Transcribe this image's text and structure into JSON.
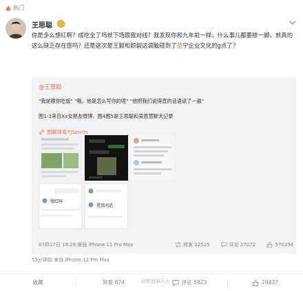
{
  "header": {
    "hot_label": "热门"
  },
  "post": {
    "username": "王思聪",
    "text_part1": "你是多么想红啊？成吃全了吗就下场跟我对线？我发现你和九年前一样，什么事儿都要掺一脚，就真的这么缺乏存在感吗？还是这次是王毅和颜毅这调触碰到了",
    "text_highlight": "圣",
    "text_part2": "宁企业文化的g点了？",
    "footer_time": "55分钟前  来自 iPhone 11 Pro Max"
  },
  "repost": {
    "user": "@王思聪",
    "line1": "\"我是跟你吃饭\" \"哦，他是怎么写你的呢\" \"他把我们说得直的话语说了一遍\"",
    "line2": "图1-3来自Xx女朋友微博，图4图5是王思聪和吴恩慧聊天记录",
    "link_text": "图解体育TJSports",
    "image_labels": [
      "想红吗",
      "是我问话"
    ],
    "meta_time": "07月17日 19:28  来自 iPhone 11 Pro Max",
    "reposts": "转发 22515",
    "comments": "评论 27072",
    "likes": "570354"
  },
  "bottom": {
    "favorite": "收藏",
    "repost": "转发 874",
    "comment": "评论 5923",
    "like": "29437",
    "watermark": "@新浪娱乐人"
  },
  "colors": {
    "accent": "#eb7350",
    "muted": "#808080",
    "repost_bg": "#f2f2f5"
  }
}
